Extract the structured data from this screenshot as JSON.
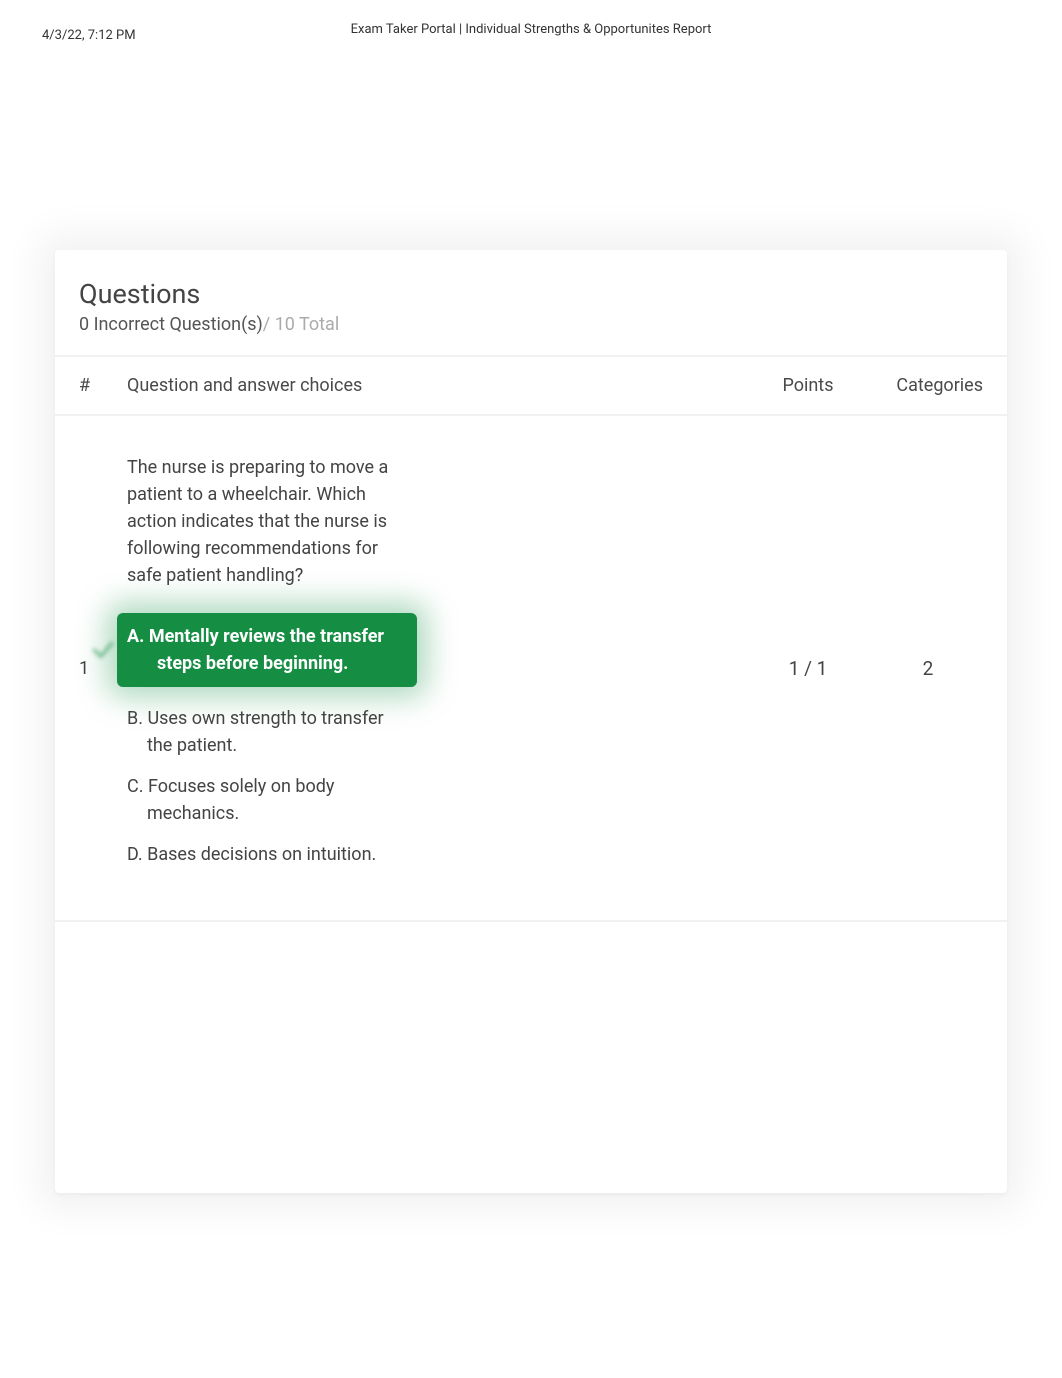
{
  "header": {
    "timestamp": "4/3/22, 7:12 PM",
    "title": "Exam Taker Portal | Individual Strengths & Opportunites Report"
  },
  "card": {
    "title": "Questions",
    "incorrect_label": "0 Incorrect Question(s)",
    "total_label": "/ 10 Total"
  },
  "columns": {
    "num": "#",
    "qa": "Question and answer choices",
    "points": "Points",
    "categories": "Categories"
  },
  "question": {
    "number": "1",
    "text": "The nurse is preparing to move a patient to a wheelchair. Which action indicates that the nurse is following recommendations for safe patient handling?",
    "points": "1 / 1",
    "categories": "2",
    "answers": {
      "a": {
        "letter": "A.",
        "line1": "Mentally reviews the transfer",
        "line2": "steps before beginning."
      },
      "b": {
        "letter": "B.",
        "line1": "Uses own strength to transfer",
        "line2": "the patient."
      },
      "c": {
        "letter": "C.",
        "line1": "Focuses solely on body",
        "line2": "mechanics."
      },
      "d": {
        "letter": "D.",
        "text": "Bases decisions on intuition."
      }
    }
  }
}
